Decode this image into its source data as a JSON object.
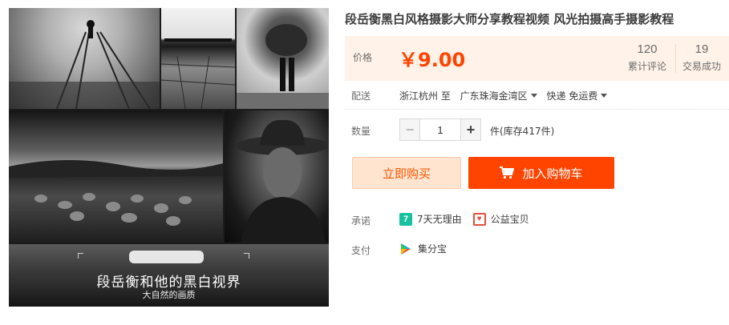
{
  "product": {
    "title": "段岳衡黑白风格摄影大师分享教程视频 风光拍摄高手摄影教程"
  },
  "gallery": {
    "caption_title": "段岳衡和他的黑白视界",
    "caption_sub": "大自然的画质"
  },
  "price": {
    "label": "价格",
    "value": "￥9.00",
    "reviews_count": "120",
    "reviews_label": "累计评论",
    "deals_count": "19",
    "deals_label": "交易成功"
  },
  "delivery": {
    "label": "配送",
    "origin": "浙江杭州 至",
    "destination": "广东珠海金湾区",
    "method": "快递 免运费"
  },
  "quantity": {
    "label": "数量",
    "value": "1",
    "minus": "−",
    "plus": "+",
    "stock_text": "件(库存417件)"
  },
  "actions": {
    "buy_now": "立即购买",
    "add_to_cart": "加入购物车"
  },
  "promise": {
    "label": "承诺",
    "items": [
      "7天无理由",
      "公益宝贝"
    ]
  },
  "payment": {
    "label": "支付",
    "method": "集分宝"
  },
  "colors": {
    "accent": "#ff4400",
    "price_bg": "#fff2e8",
    "buy_now_bg": "#ffe4d0"
  }
}
